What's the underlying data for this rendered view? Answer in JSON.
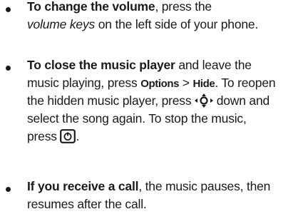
{
  "items": [
    {
      "bold": "To change the volume",
      "line1_rest": ", press the",
      "line2_italic": "volume keys",
      "line2_rest": " on the left side of your phone."
    },
    {
      "bold": "To close the music player",
      "line1_rest": " and leave the",
      "line2": "music playing, press ",
      "options_key": "Options",
      "separator": " > ",
      "hide_key": "Hide",
      "line2_tail": ". To reopen",
      "line3_pre": "the hidden music player, press ",
      "line3_post": " down and",
      "line4": "select the song again. To stop the music,",
      "line5_pre": "press ",
      "line5_post": "."
    },
    {
      "bold": "If you receive a call",
      "line1_rest": ", the music pauses, then",
      "line2": "resumes after the call."
    }
  ],
  "icons": {
    "nav_key": "navigation-key-icon",
    "end_key": "end-power-key-icon"
  }
}
